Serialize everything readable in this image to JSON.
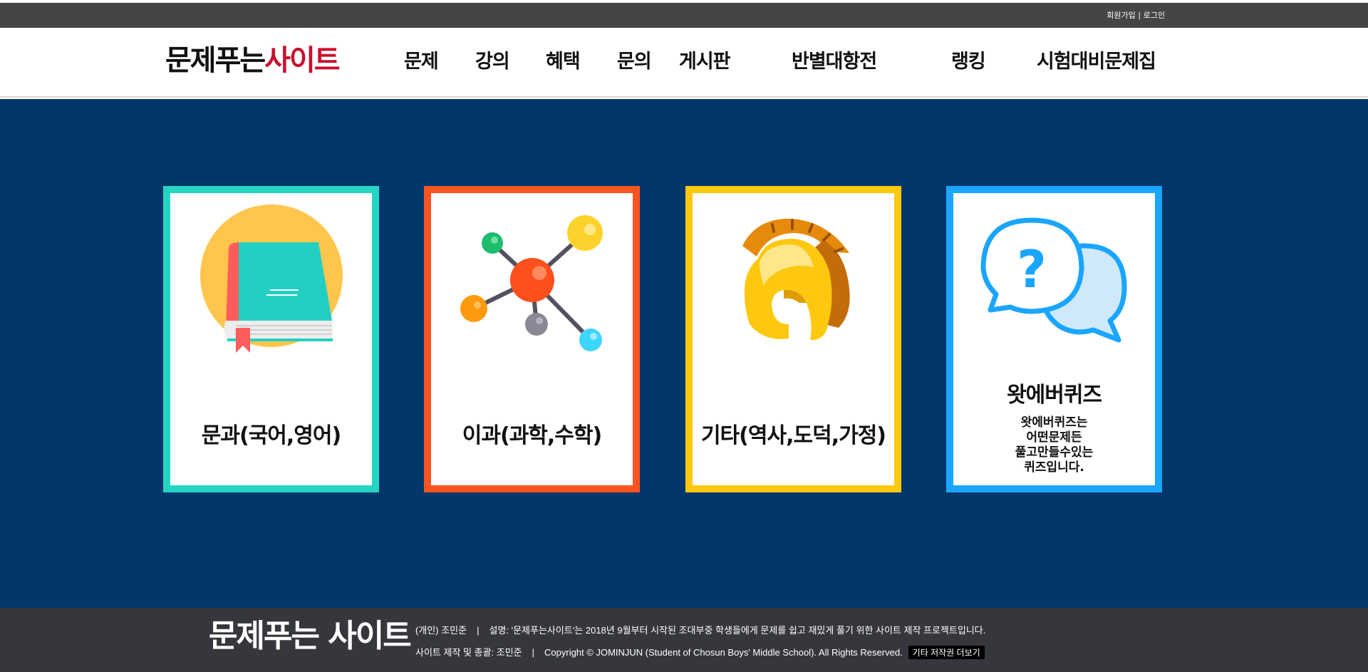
{
  "topbar": {
    "signup": "회원가입",
    "separator": "|",
    "login": "로그인"
  },
  "header": {
    "logo_main": "문제푸는",
    "logo_accent": "사이트",
    "nav": [
      "문제",
      "강의",
      "혜택",
      "문의",
      "게시판",
      "반별대항전",
      "랭킹",
      "시험대비문제집"
    ]
  },
  "colors": {
    "topbar": "#454545",
    "main_bg": "#03376b",
    "footer_bg": "#35373d",
    "logo_accent": "#c8102e",
    "card_teal": "#25d5c3",
    "card_orange": "#fa5421",
    "card_yellow": "#fdc80f",
    "card_blue": "#1aa5ff"
  },
  "cards": [
    {
      "title": "문과(국어,영어)",
      "icon": "book-icon",
      "border": "#25d5c3"
    },
    {
      "title": "이과(과학,수학)",
      "icon": "molecule-icon",
      "border": "#fa5421"
    },
    {
      "title": "기타(역사,도덕,가정)",
      "icon": "spartan-helmet-icon",
      "border": "#fdc80f"
    },
    {
      "title": "왓에버퀴즈",
      "icon": "question-chat-icon",
      "border": "#1aa5ff",
      "description": [
        "왓에버퀴즈는",
        "어떤문제든",
        "풀고만들수있는",
        "퀴즈입니다."
      ]
    }
  ],
  "footer": {
    "logo": "문제푸는 사이트",
    "line1_owner": "(개인) 조민준",
    "line1_sep": "|",
    "line1_desc": "설명: '문제푸는사이트'는 2018년 9월부터 시작된 조대부중 학생들에게 문제를 쉽고 재밌게 풀기 위한 사이트 제작 프로젝트입니다.",
    "line2_maker": "사이트 제작 및 총괄: 조민준",
    "line2_sep": "|",
    "line2_copyright": "Copyright © JOMINJUN (Student of Chosun Boys' Middle School). All Rights Reserved.",
    "more_button": "기타 저작권 더보기"
  }
}
